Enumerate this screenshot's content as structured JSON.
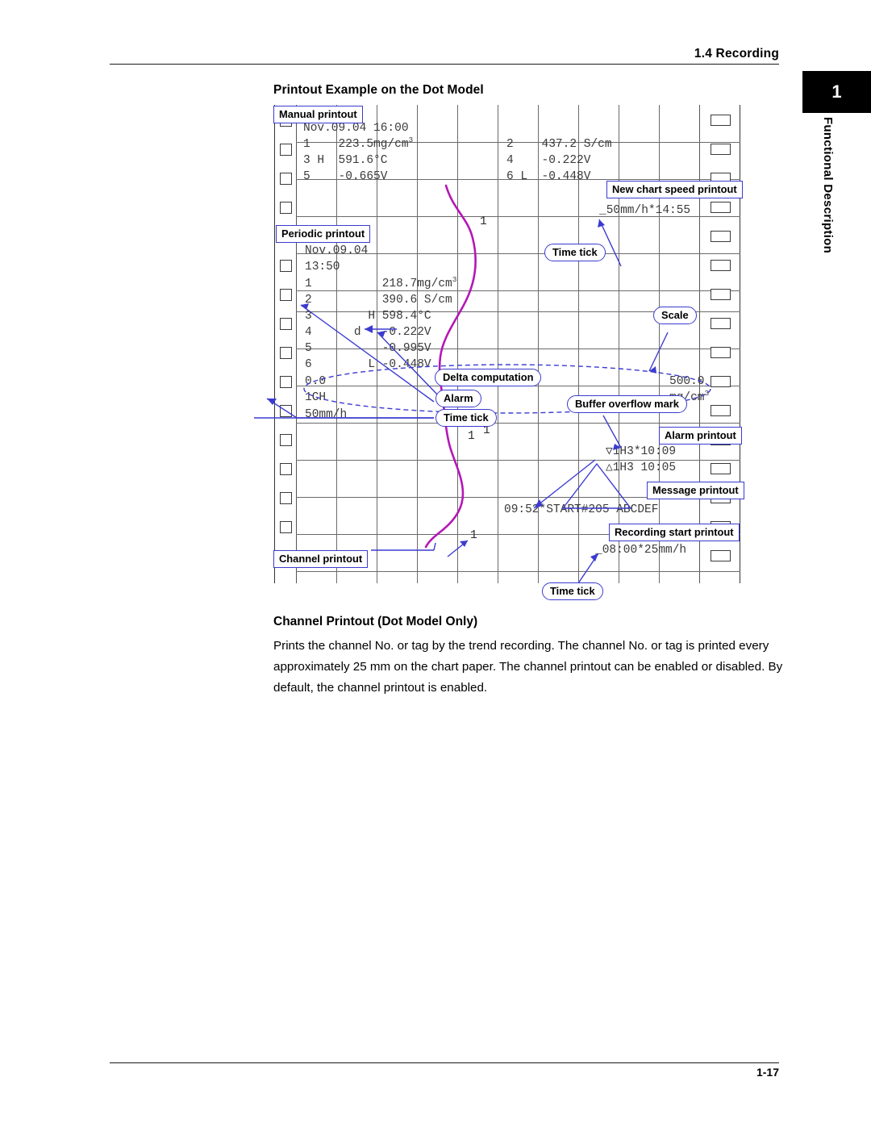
{
  "header": {
    "title": "1.4  Recording"
  },
  "chapter_tab": {
    "number": "1",
    "label": "Functional Description"
  },
  "section": {
    "heading": "Printout Example on the Dot Model"
  },
  "chart": {
    "manual_printout": {
      "line1": "Nov.09.04 16:00",
      "line2_left": "1    223.5mg/cm",
      "line2_left_sup": "3",
      "line2_right": "2    437.2 S/cm",
      "line3_left": "3 H  591.6°C",
      "line3_right": "4    -0.222V",
      "line4_left": "5    -0.665V",
      "line4_right": "6 L  -0.448V"
    },
    "new_chart_speed": "_50mm/h*14:55",
    "periodic_printout": {
      "date": "Nov.09.04",
      "time": "13:50",
      "rows": [
        "1          218.7mg/cm",
        "2          390.6 S/cm",
        "3        H 598.4°C",
        "4      d   -0.222V",
        "5          -0.995V",
        "6        L -0.448V"
      ],
      "row0_sup": "3"
    },
    "scale": {
      "min": "0.0",
      "max": "500.0",
      "channel": "1CH",
      "unit": "mg/cm",
      "unit_sup": "3",
      "speed": "50mm/h_"
    },
    "alarm_printout": {
      "line1": "▽1H3*10:09",
      "line2": "△1H3 10:05"
    },
    "message_printout": "09:52*START#205 ABCDEF",
    "recording_start_printout": "_08:00*25mm/h",
    "channel_marks": [
      "1",
      "1",
      "1",
      "1"
    ]
  },
  "callouts": {
    "manual_printout": "Manual printout",
    "new_chart_speed_printout": "New chart speed printout",
    "periodic_printout": "Periodic printout",
    "time_tick_1": "Time tick",
    "scale": "Scale",
    "delta_computation": "Delta computation",
    "alarm": "Alarm",
    "buffer_overflow_mark": "Buffer overflow mark",
    "time_tick_2": "Time tick",
    "alarm_printout": "Alarm printout",
    "message_printout": "Message printout",
    "recording_start_printout": "Recording start printout",
    "channel_printout": "Channel printout",
    "time_tick_3": "Time tick"
  },
  "body": {
    "heading": "Channel Printout (Dot Model Only)",
    "paragraph": "Prints the channel No. or tag by the trend recording.  The channel No. or tag is printed every approximately 25 mm on the chart paper.  The channel printout can be enabled or disabled.  By default, the channel printout is enabled."
  },
  "footer": {
    "page_number": "1-17"
  },
  "colors": {
    "callout_border": "#3b3bd0",
    "trend_line": "#b517b5",
    "grid": "#6a6a6a",
    "dot_text": "#3a3a3a"
  }
}
